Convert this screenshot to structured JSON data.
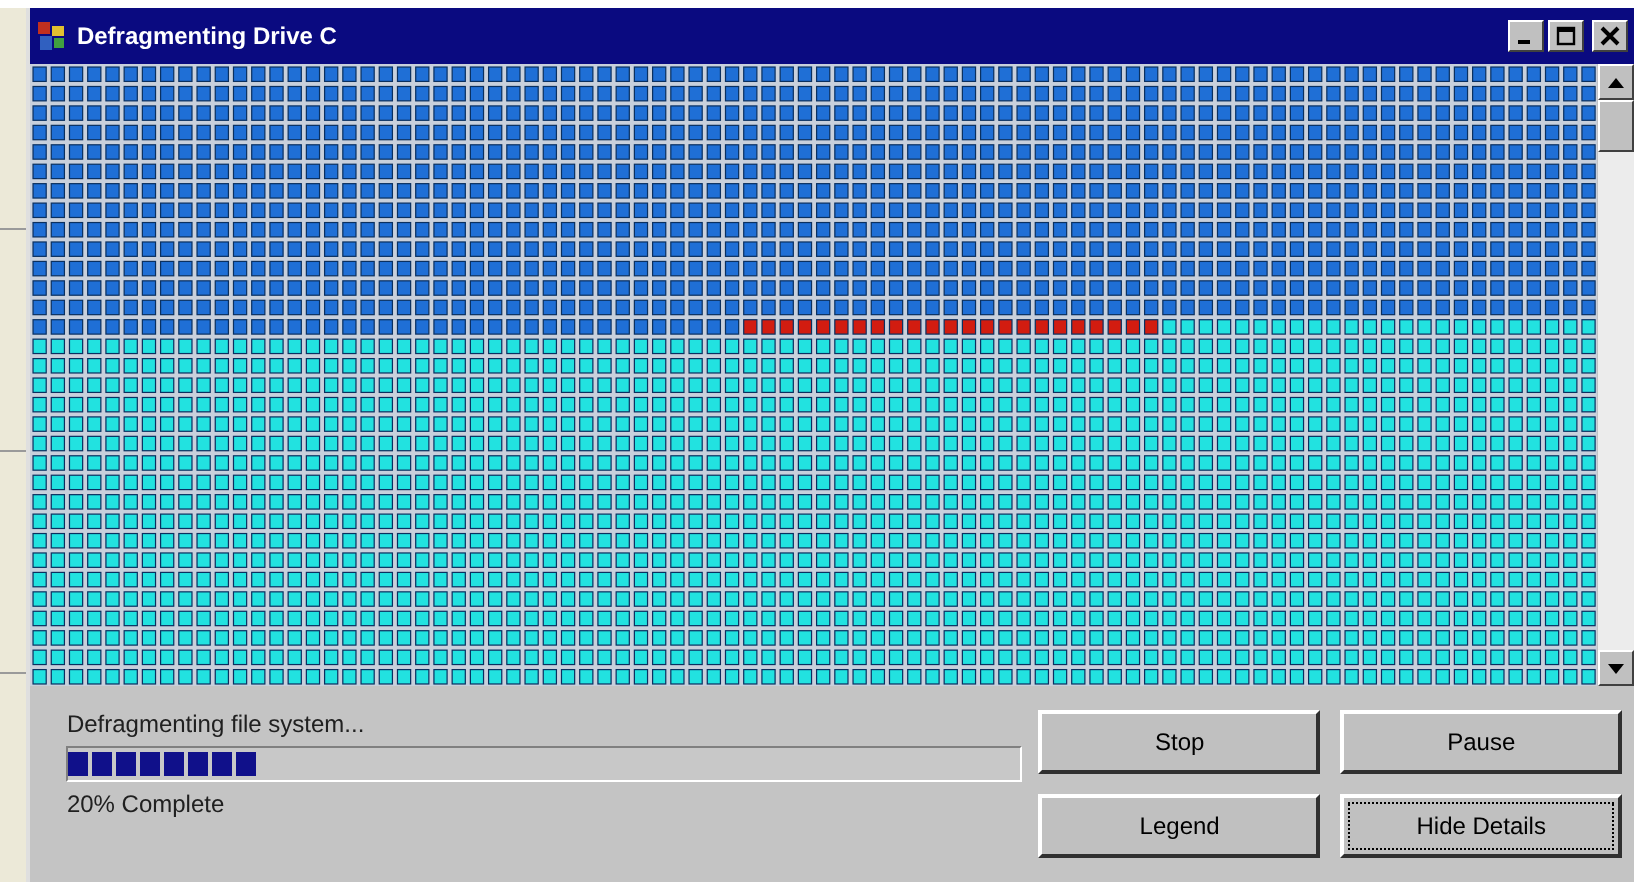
{
  "window": {
    "title": "Defragmenting Drive C"
  },
  "status": {
    "text": "Defragmenting file system...",
    "level": 0.2,
    "reading": "20% Complete"
  },
  "buttons": [
    {
      "label": "Stop",
      "focused": false
    },
    {
      "label": "Pause",
      "focused": false
    },
    {
      "label": "Legend",
      "focused": false
    },
    {
      "label": "Hide Details",
      "focused": true
    }
  ]
}
